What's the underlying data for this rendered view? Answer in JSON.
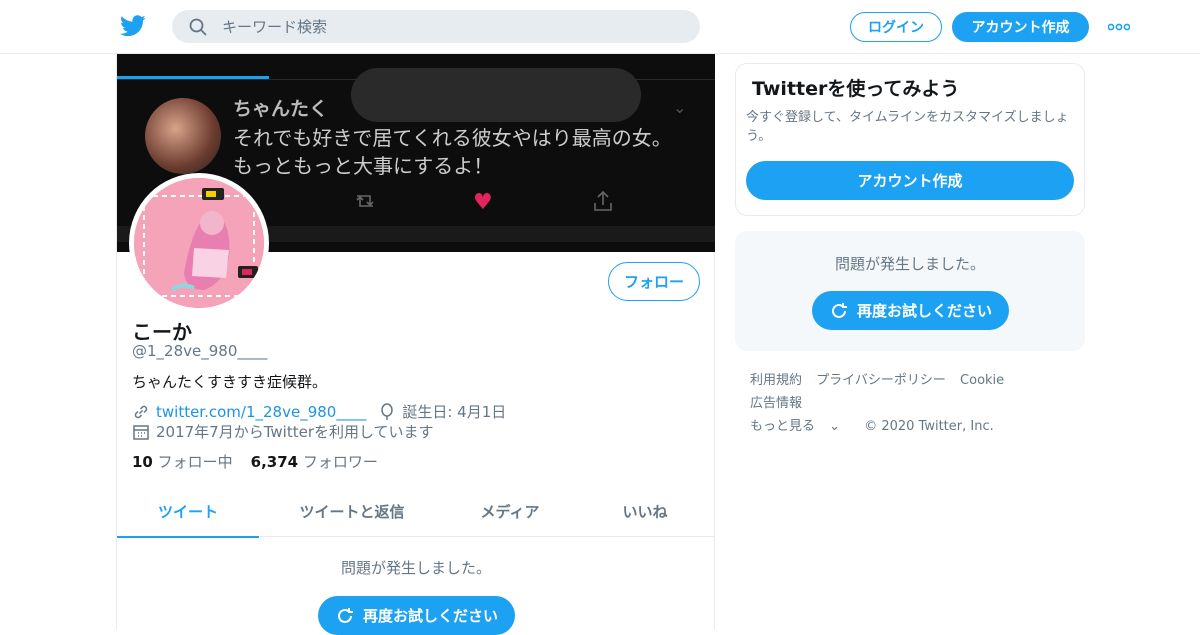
{
  "header": {
    "search_placeholder": "キーワード検索",
    "login_label": "ログイン",
    "signup_label": "アカウント作成",
    "icons": {
      "logo": "twitter-bird-icon",
      "search": "search-icon",
      "more": "more-dots-icon"
    },
    "accent_color": "#1da1f2"
  },
  "banner": {
    "tweet_author": "ちゃんたく",
    "tweet_line1": "それでも好きで居てくれる彼女やはり最高の女。",
    "tweet_line2": "もっともっと大事にするよ！"
  },
  "profile": {
    "display_name": "こーか",
    "handle": "@1_28ve_980____",
    "bio": "ちゃんたくすきすき症候群。",
    "website": "twitter.com/1_28ve_980____",
    "birthday": "誕生日: 4月1日",
    "joined": "2017年7月からTwitterを利用しています",
    "following_count": "10",
    "following_label": "フォロー中",
    "followers_count": "6,374",
    "followers_label": "フォロワー",
    "follow_button": "フォロー"
  },
  "tabs": [
    "ツイート",
    "ツイートと返信",
    "メディア",
    "いいね"
  ],
  "timeline": {
    "error_message": "問題が発生しました。",
    "retry_label": "再度お試しください"
  },
  "sidebar": {
    "promo_title": "Twitterを使ってみよう",
    "promo_text": "今すぐ登録して、タイムラインをカスタマイズしましょう。",
    "promo_button": "アカウント作成",
    "error_message": "問題が発生しました。",
    "retry_label": "再度お試しください"
  },
  "footer": {
    "links": [
      "利用規約",
      "プライバシーポリシー",
      "Cookie",
      "広告情報"
    ],
    "more_label": "もっと見る",
    "copyright": "© 2020 Twitter, Inc."
  }
}
